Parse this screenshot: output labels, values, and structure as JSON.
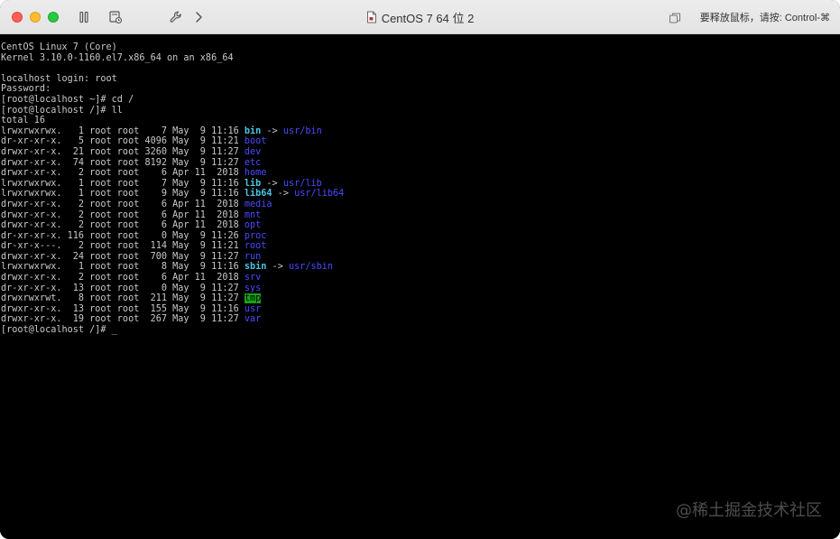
{
  "window": {
    "title": "CentOS 7 64 位 2",
    "hint": "要释放鼠标，请按: Control-⌘"
  },
  "toolbar": {
    "icons": [
      "pause-icon",
      "snapshot-icon",
      "wrench-icon",
      "chevron-right-icon"
    ]
  },
  "console": {
    "header": [
      "CentOS Linux 7 (Core)",
      "Kernel 3.10.0-1160.el7.x86_64 on an x86_64",
      "",
      "localhost login: root",
      "Password:",
      "[root@localhost ~]# cd /",
      "[root@localhost /]# ll",
      "total 16"
    ],
    "entries": [
      {
        "meta": "lrwxrwxrwx.   1 root root    7 May  9 11:16 ",
        "name": "bin",
        "kind": "link",
        "target": "usr/bin"
      },
      {
        "meta": "dr-xr-xr-x.   5 root root 4096 May  9 11:21 ",
        "name": "boot",
        "kind": "dir"
      },
      {
        "meta": "drwxr-xr-x.  21 root root 3260 May  9 11:27 ",
        "name": "dev",
        "kind": "dir"
      },
      {
        "meta": "drwxr-xr-x.  74 root root 8192 May  9 11:27 ",
        "name": "etc",
        "kind": "dir"
      },
      {
        "meta": "drwxr-xr-x.   2 root root    6 Apr 11  2018 ",
        "name": "home",
        "kind": "dir"
      },
      {
        "meta": "lrwxrwxrwx.   1 root root    7 May  9 11:16 ",
        "name": "lib",
        "kind": "link",
        "target": "usr/lib"
      },
      {
        "meta": "lrwxrwxrwx.   1 root root    9 May  9 11:16 ",
        "name": "lib64",
        "kind": "link",
        "target": "usr/lib64"
      },
      {
        "meta": "drwxr-xr-x.   2 root root    6 Apr 11  2018 ",
        "name": "media",
        "kind": "dir"
      },
      {
        "meta": "drwxr-xr-x.   2 root root    6 Apr 11  2018 ",
        "name": "mnt",
        "kind": "dir"
      },
      {
        "meta": "drwxr-xr-x.   2 root root    6 Apr 11  2018 ",
        "name": "opt",
        "kind": "dir"
      },
      {
        "meta": "dr-xr-xr-x. 116 root root    0 May  9 11:26 ",
        "name": "proc",
        "kind": "dir"
      },
      {
        "meta": "dr-xr-x---.   2 root root  114 May  9 11:21 ",
        "name": "root",
        "kind": "dir"
      },
      {
        "meta": "drwxr-xr-x.  24 root root  700 May  9 11:27 ",
        "name": "run",
        "kind": "dir"
      },
      {
        "meta": "lrwxrwxrwx.   1 root root    8 May  9 11:16 ",
        "name": "sbin",
        "kind": "link",
        "target": "usr/sbin"
      },
      {
        "meta": "drwxr-xr-x.   2 root root    6 Apr 11  2018 ",
        "name": "srv",
        "kind": "dir"
      },
      {
        "meta": "dr-xr-xr-x.  13 root root    0 May  9 11:27 ",
        "name": "sys",
        "kind": "dir"
      },
      {
        "meta": "drwxrwxrwt.   8 root root  211 May  9 11:27 ",
        "name": "tmp",
        "kind": "sticky"
      },
      {
        "meta": "drwxr-xr-x.  13 root root  155 May  9 11:16 ",
        "name": "usr",
        "kind": "dir"
      },
      {
        "meta": "drwxr-xr-x.  19 root root  267 May  9 11:27 ",
        "name": "var",
        "kind": "dir"
      }
    ],
    "prompt": "[root@localhost /]# ",
    "cursor": "_"
  },
  "watermark": "@稀土掘金技术社区",
  "colors": {
    "terminal_bg": "#000000",
    "terminal_fg": "#c8c8c8",
    "dir": "#4a4aff",
    "link": "#49c6e5",
    "sticky_bg": "#18a418"
  }
}
